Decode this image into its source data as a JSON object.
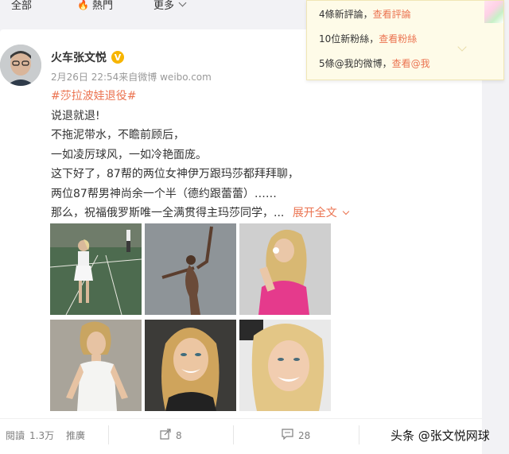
{
  "nav": {
    "all_label": "全部",
    "hot_label": "熱門",
    "more_label": "更多",
    "hot_icon": "flame-icon",
    "more_icon": "chevron-down-icon"
  },
  "post": {
    "author": "火车张文悦",
    "verified_icon": "verified-v-icon",
    "meta": "2月26日 22:54来自微博 weibo.com",
    "topic": "#莎拉波娃退役#",
    "lines": [
      "说退就退!",
      "不拖泥带水，不瞻前顾后，",
      "一如凌厉球风，一如冷艳面庞。",
      "这下好了，87帮的两位女神伊万跟玛莎都拜拜聊，",
      "两位87帮男神尚余一个半（德约跟蕾蕾）……",
      "那么，祝福俄罗斯唯一全满贯得主玛莎同学，..."
    ],
    "expand_label": "展开全文",
    "photo_names": [
      "photo-tennis-court",
      "photo-dance-pose",
      "photo-pink-top",
      "photo-white-tank",
      "photo-smiling-portrait",
      "photo-closeup-smile"
    ]
  },
  "footer": {
    "read_label": "閱讀",
    "read_count": "1.3万",
    "promote_label": "推廣",
    "share_count": "8",
    "comment_count": "28"
  },
  "notifications": {
    "comments_text": "4條新評論，",
    "comments_link": "查看評論",
    "fans_text": "10位新粉絲，",
    "fans_link": "查看粉絲",
    "mentions_text": "5條@我的微博，",
    "mentions_link": "查看@我"
  },
  "watermark": "头条 @张文悦网球",
  "colors": {
    "accent": "#eb7350",
    "verified": "#f7b500",
    "notify_bg": "#fefbe8"
  }
}
